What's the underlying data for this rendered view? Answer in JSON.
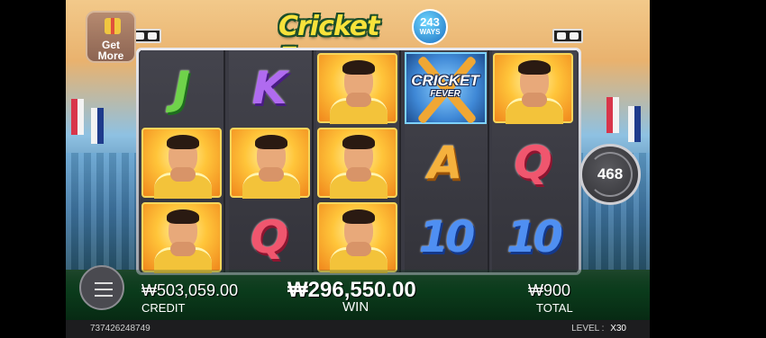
{
  "game": {
    "title": "Cricket Fever",
    "ways": {
      "number": "243",
      "label": "WAYS"
    },
    "get_more": {
      "line1": "Get",
      "line2": "More"
    },
    "spin_count": "468"
  },
  "reels": [
    [
      "J",
      "player",
      "player"
    ],
    [
      "K",
      "player",
      "Q"
    ],
    [
      "player",
      "player",
      "player"
    ],
    [
      "wild",
      "A",
      "10"
    ],
    [
      "player",
      "Q",
      "10"
    ]
  ],
  "wild_symbol": {
    "line1": "CRICKET",
    "line2": "FEVER"
  },
  "stats": {
    "credit": {
      "value": "₩503,059.00",
      "label": "CREDIT"
    },
    "win": {
      "value": "₩296,550.00",
      "label": "WIN"
    },
    "total": {
      "value": "₩900",
      "label": "TOTAL"
    }
  },
  "footer": {
    "round_id": "737426248749",
    "level_label": "LEVEL :",
    "level_value": "X30"
  },
  "colors": {
    "letter_J": "#6fd34a",
    "letter_K": "#b06bf0",
    "letter_A": "#f5b13d",
    "letter_Q": "#f0566e",
    "letter_10": "#4f8ff2"
  },
  "icons": [
    "menu-icon",
    "gift-icon",
    "spin-icon"
  ]
}
